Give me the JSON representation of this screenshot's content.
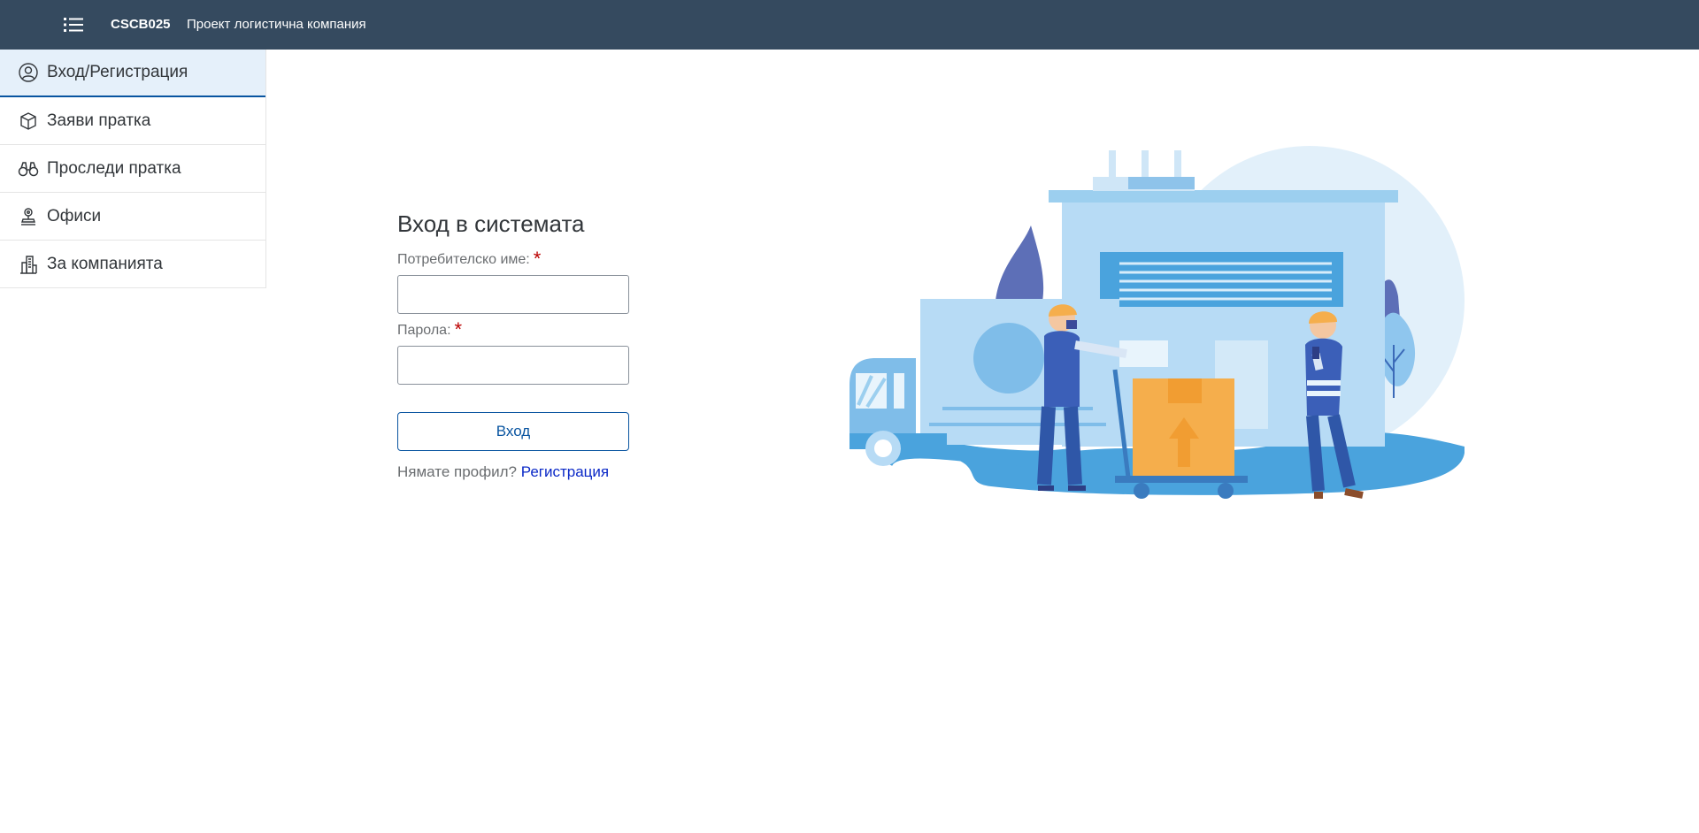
{
  "header": {
    "app_id": "CSCB025",
    "app_title": "Проект логистична компания",
    "menu_icon": "list-icon"
  },
  "sidebar": {
    "items": [
      {
        "label": "Вход/Регистрация",
        "icon": "user-circle-icon",
        "active": true
      },
      {
        "label": "Заяви пратка",
        "icon": "package-icon",
        "active": false
      },
      {
        "label": "Проследи пратка",
        "icon": "binoculars-icon",
        "active": false
      },
      {
        "label": "Офиси",
        "icon": "location-stand-icon",
        "active": false
      },
      {
        "label": "За компанията",
        "icon": "company-building-icon",
        "active": false
      }
    ]
  },
  "login": {
    "title": "Вход в системата",
    "username_label": "Потребителско име:",
    "password_label": "Парола:",
    "required_mark": "*",
    "username_value": "",
    "password_value": "",
    "submit_label": "Вход",
    "no_profile_text": "Нямате профил?",
    "register_link": "Регистрация"
  },
  "colors": {
    "shell_bar": "#354a5f",
    "accent": "#0854a0",
    "required": "#bb0000",
    "link": "#0a28c7"
  }
}
